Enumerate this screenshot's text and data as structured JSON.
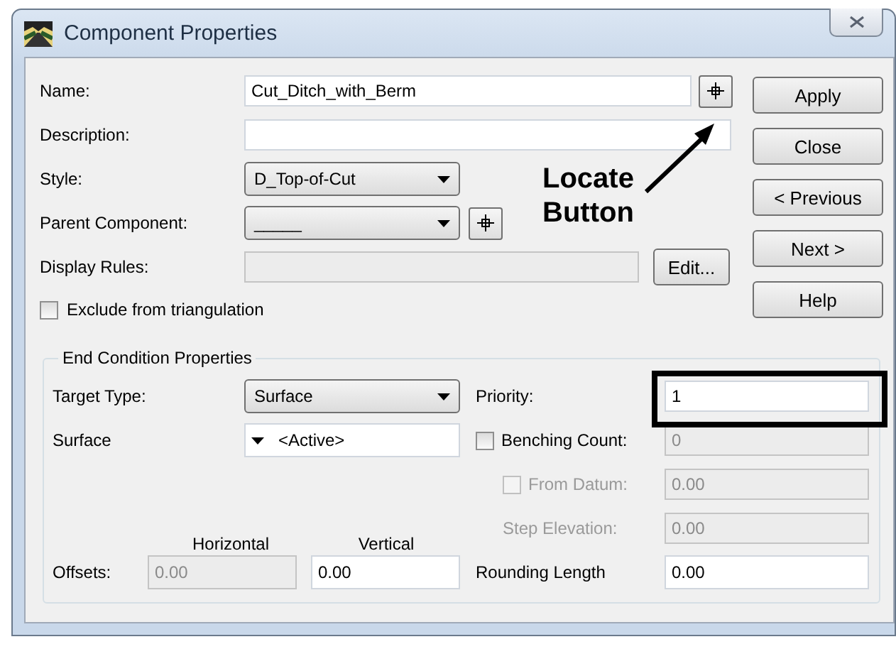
{
  "window": {
    "title": "Component Properties"
  },
  "fields": [
    {
      "kind": "text",
      "label": "Name:",
      "value": "Cut_Ditch_with_Berm",
      "locate": true,
      "disabled": false
    },
    {
      "kind": "text",
      "label": "Description:",
      "locate": false,
      "disabled": false
    },
    {
      "kind": "dropdown",
      "label": "Style:",
      "value": "D_Top-of-Cut",
      "locate": false,
      "disabled": false
    },
    {
      "kind": "dropdown",
      "label": "Parent Component:",
      "value": "_____",
      "locate": true,
      "disabled": false
    },
    {
      "kind": "edit",
      "label": "Display Rules:",
      "button": "Edit...",
      "locate": false,
      "disabled": true
    }
  ],
  "buttons": [
    "Apply",
    "Close",
    "< Previous",
    "Next >",
    "Help"
  ],
  "exclude": {
    "label": "Exclude from triangulation",
    "checked": false
  },
  "end_condition": {
    "title": "End Condition Properties",
    "target_type": {
      "label": "Target Type:",
      "value": "Surface"
    },
    "surface": {
      "label": "Surface",
      "value": "<Active>"
    },
    "priority": {
      "label": "Priority:",
      "value": "1",
      "highlighted": true
    },
    "benching": {
      "label": "Benching Count:",
      "checked": false,
      "disabled": false,
      "value": "0",
      "value_disabled": true
    },
    "from_datum": {
      "label": "From Datum:",
      "checked": false,
      "disabled": true,
      "value": "0.00"
    },
    "step_elevation": {
      "label": "Step Elevation:",
      "disabled": true,
      "value": "0.00"
    },
    "offsets": {
      "label": "Offsets:",
      "horizontal_heading": "Horizontal",
      "vertical_heading": "Vertical",
      "horizontal_value": "0.00",
      "horizontal_disabled": true,
      "vertical_value": "0.00",
      "vertical_disabled": false
    },
    "rounding": {
      "label": "Rounding Length",
      "value": "0.00"
    }
  },
  "callout": {
    "text": "Locate Button"
  }
}
